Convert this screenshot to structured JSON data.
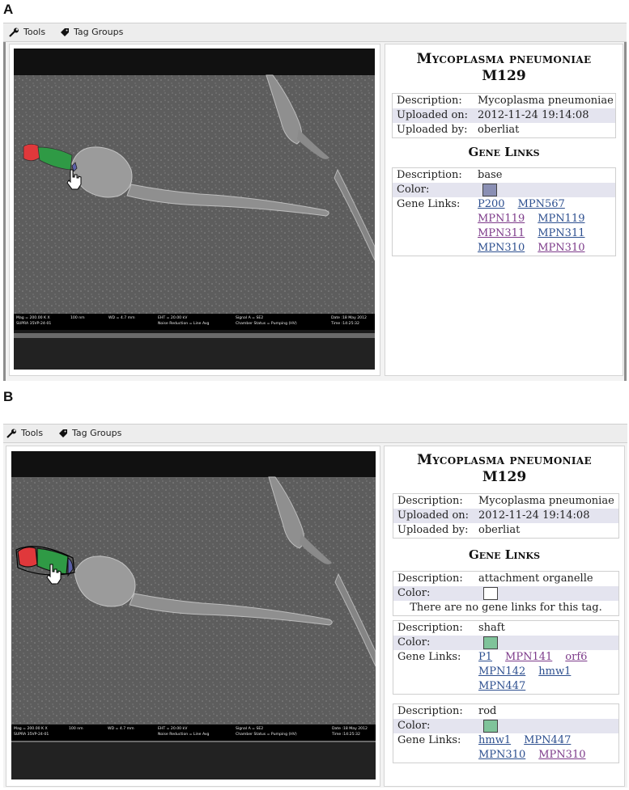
{
  "panel_a": {
    "letter": "A",
    "toolbar": {
      "tools_label": "Tools",
      "tag_groups_label": "Tag Groups"
    },
    "sem_footer": {
      "mag": "Mag = 200.00 K X",
      "scale": "100 nm",
      "wd": "WD = 4.7 mm",
      "eht": "EHT = 20.00 kV",
      "signal": "Signal A = SE2",
      "date": "Date :18 May 2012",
      "supra": "SUPRA 35VP-24-01",
      "noise": "Noise Reduction = Line Avg",
      "chamber": "Chamber Status = Pumping (HV)",
      "time": "Time :14:25:32"
    },
    "info": {
      "organism": "Mycoplasma pneumoniae",
      "strain": "M129",
      "desc_label": "Description:",
      "desc_value": "Mycoplasma pneumoniae",
      "uploaded_on_label": "Uploaded on:",
      "uploaded_on_value": "2012-11-24 19:14:08",
      "uploaded_by_label": "Uploaded by:",
      "uploaded_by_value": "oberliat",
      "gene_links_title": "Gene Links"
    },
    "tags": [
      {
        "desc_label": "Description:",
        "desc_value": "base",
        "color_label": "Color:",
        "color": "#8a8fb4",
        "links_label": "Gene Links:",
        "links": [
          "P200",
          "MPN567",
          "MPN119",
          "MPN119",
          "MPN311",
          "MPN311",
          "MPN310",
          "MPN310"
        ]
      }
    ]
  },
  "panel_b": {
    "letter": "B",
    "toolbar": {
      "tools_label": "Tools",
      "tag_groups_label": "Tag Groups"
    },
    "sem_footer": {
      "mag": "Mag = 200.00 K X",
      "scale": "100 nm",
      "wd": "WD = 4.7 mm",
      "eht": "EHT = 20.00 kV",
      "signal": "Signal A = SE2",
      "date": "Date :18 May 2012",
      "supra": "SUPRA 35VP-24-01",
      "noise": "Noise Reduction = Line Avg",
      "chamber": "Chamber Status = Pumping (HV)",
      "time": "Time :14:25:32"
    },
    "info": {
      "organism": "Mycoplasma pneumoniae",
      "strain": "M129",
      "desc_label": "Description:",
      "desc_value": "Mycoplasma pneumoniae",
      "uploaded_on_label": "Uploaded on:",
      "uploaded_on_value": "2012-11-24 19:14:08",
      "uploaded_by_label": "Uploaded by:",
      "uploaded_by_value": "oberliat",
      "gene_links_title": "Gene Links"
    },
    "tags": [
      {
        "desc_label": "Description:",
        "desc_value": "attachment organelle",
        "color_label": "Color:",
        "color": "#ffffff",
        "no_links_message": "There are no gene links for this tag."
      },
      {
        "desc_label": "Description:",
        "desc_value": "shaft",
        "color_label": "Color:",
        "color": "#7fc39a",
        "links_label": "Gene Links:",
        "links": [
          "P1",
          "MPN141",
          "orf6",
          "MPN142",
          "hmw1",
          "MPN447"
        ]
      },
      {
        "desc_label": "Description:",
        "desc_value": "rod",
        "color_label": "Color:",
        "color": "#7fc39a",
        "links_label": "Gene Links:",
        "links": [
          "hmw1",
          "MPN447",
          "MPN310",
          "MPN310"
        ]
      }
    ]
  }
}
